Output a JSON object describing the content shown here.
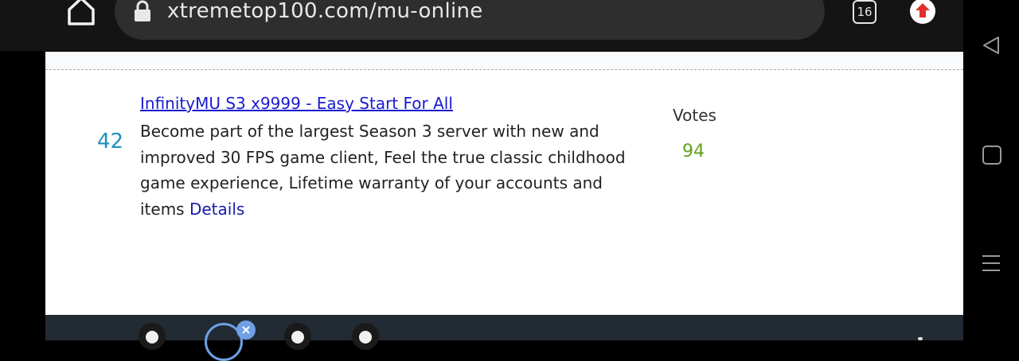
{
  "browser": {
    "url": "xtremetop100.com/mu-online",
    "tab_count": "16"
  },
  "listing": {
    "rank": "42",
    "title": "InfinityMU S3 x9999 - Easy Start For All",
    "description": "Become part of the largest Season 3 server with new and improved 30 FPS game client, Feel the true classic childhood game experience, Lifetime warranty of your accounts and items",
    "details_label": "Details",
    "votes_label": "Votes",
    "votes_value": "94"
  },
  "bottom_bar": {
    "close_label": "×"
  },
  "icons": {
    "home": "home-icon",
    "lock": "lock-icon",
    "tabs": "tabs-icon",
    "update": "update-arrow-icon",
    "back": "back-triangle-icon",
    "recents": "square-icon",
    "menu": "hamburger-icon"
  },
  "colors": {
    "rank": "#1f8fc0",
    "link": "#1a1ad0",
    "votes": "#62a11d",
    "accent_update": "#e0302a"
  }
}
